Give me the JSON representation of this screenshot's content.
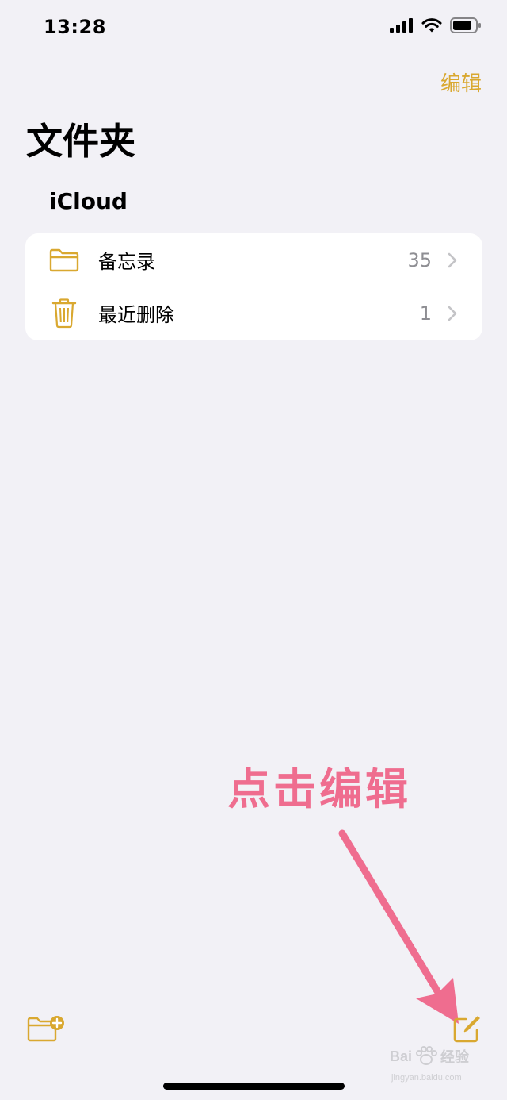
{
  "status_bar": {
    "time": "13:28"
  },
  "nav": {
    "edit_label": "编辑"
  },
  "page": {
    "title": "文件夹"
  },
  "account": {
    "name": "iCloud"
  },
  "folders": [
    {
      "icon": "folder-icon",
      "label": "备忘录",
      "count": "35"
    },
    {
      "icon": "trash-icon",
      "label": "最近删除",
      "count": "1"
    }
  ],
  "annotation": {
    "text": "点击编辑"
  },
  "toolbar": {
    "left_icon": "new-folder-icon",
    "right_icon": "compose-icon"
  },
  "watermark": {
    "brand": "Bai",
    "brand_suffix": "经验",
    "url": "jingyan.baidu.com"
  },
  "colors": {
    "accent": "#d9a830",
    "background": "#f2f1f6",
    "annotation": "#ef6d8f",
    "secondary_text": "#8e8e93"
  }
}
